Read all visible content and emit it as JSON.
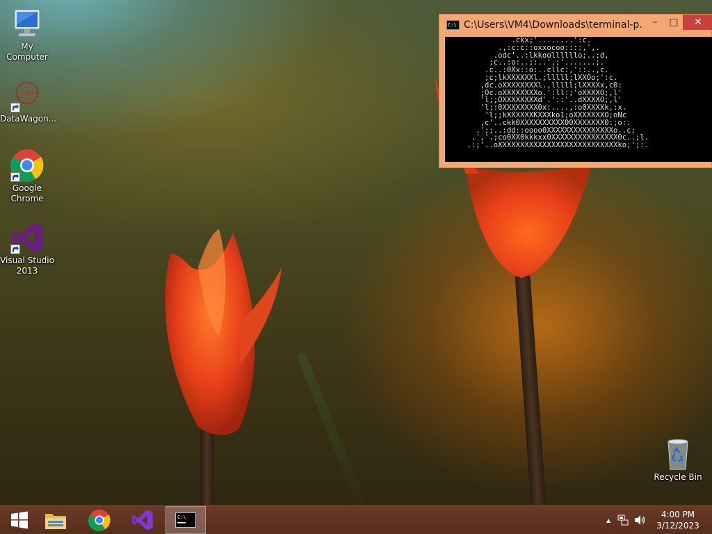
{
  "desktop": {
    "icons": [
      {
        "label": "My Computer"
      },
      {
        "label": "DataWagon..."
      },
      {
        "label": "Google\nChrome",
        "line1": "Google",
        "line2": "Chrome"
      },
      {
        "label": "Visual Studio 2013",
        "line1": "Visual Studio",
        "line2": "2013"
      },
      {
        "label": "Recycle Bin"
      }
    ]
  },
  "terminal": {
    "title": "C:\\Users\\VM4\\Downloads\\terminal-p...",
    "icon": "cmd-icon",
    "controls": {
      "minimize": "–",
      "maximize": "□",
      "close": "✕"
    },
    "output": "              .ckx;'........':c.\n           .,:c:c::oxxocoo::::,',.\n          .odc'..:lkkoollllllo;..;d,\n         ;c..:o:..;:..',;'.......;.\n        .c..:0Xx::o:..cllc:,'::..,c.\n        ;c;lkXXXXXXl.;lllll;lXXOo;':c.\n       ,dc.oXXXXXXXXl.,lllll;lXXXXx,c0:\n       ;Oc.oXXXXXXXXo.':ll:;'oXXXXO;,l'\n       'l;;OXXXXXXXXd'.'::'..dXXXXO;,l'\n       'l;:0XXXXXXXX0x:....,:o0XXXXk,:x.\n        'l;;kXXXXXXKXXXko1;oXXXXXXXO;oNc\n       ,c'..ckk0XXXXXXXXXX00XXXXXXX0:;o:.\n      .';;..:dd::oooo0XXXXXXXXXXXXXXXo..c;\n     .','.;co0XX0kkkxx0XXXXXXXXXXXXXXX0c..;l.\n    .:;'..oXXXXXXXXXXXXXXXXXXXXXXXXXXXko;';:."
  },
  "taskbar": {
    "start": "windows-logo-icon",
    "pinned": [
      "file-explorer-icon",
      "chrome-icon",
      "visual-studio-icon",
      "command-prompt-icon"
    ],
    "active": "command-prompt-icon",
    "tray": {
      "show_hidden": "▲",
      "network": "network-icon",
      "volume": "volume-icon"
    },
    "time": "4:00 PM",
    "date": "3/12/2023"
  },
  "colors": {
    "terminal_frame": "#f5a773",
    "close_button": "#c7423a",
    "taskbar": "#6e3c28"
  }
}
